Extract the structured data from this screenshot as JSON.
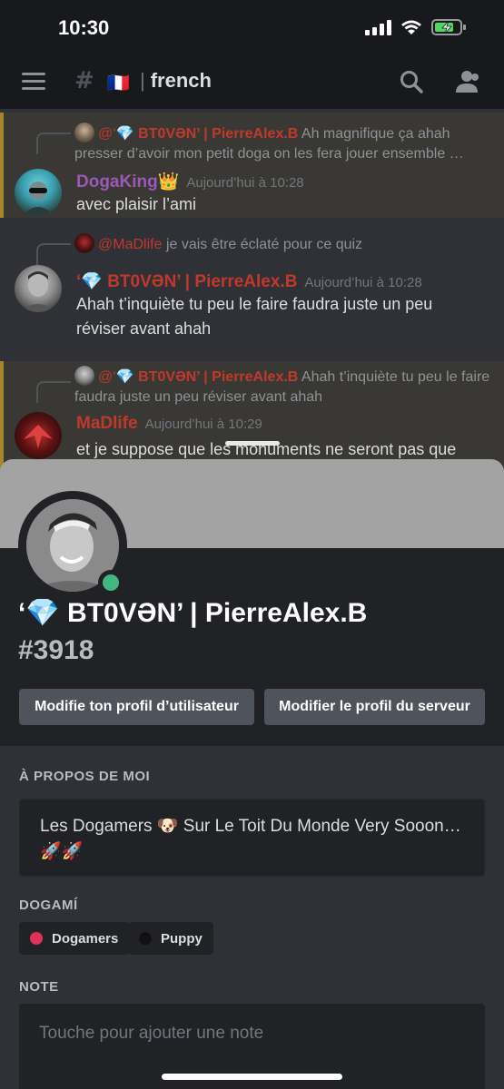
{
  "status_bar": {
    "time": "10:30"
  },
  "header": {
    "flag": "🇫🇷",
    "separator": "|",
    "channel_name": "french",
    "icons": [
      "menu-icon",
      "channel-hash-lock-icon",
      "search-icon",
      "members-icon"
    ]
  },
  "messages": [
    {
      "reply_prefix": "@‘💎",
      "reply_name": "BT0VƏN’ | PierreAlex.B",
      "reply_text": "Ah magnifique ça ahah presser d’avoir mon petit doga on les fera jouer ensemble …",
      "author": "DogaKing👑",
      "author_color": "#9b59b6",
      "timestamp": "Aujourd’hui à 10:28",
      "text": "avec plaisir l’ami"
    },
    {
      "reply_name": "@MaDlife",
      "reply_text": "je vais être éclaté pour ce quiz",
      "author": "‘💎 BT0VƏN’ | PierreAlex.B",
      "author_color": "#c0392b",
      "timestamp": "Aujourd’hui à 10:28",
      "text": "Ahah t’inquiète tu peu le faire faudra juste un peu réviser avant ahah"
    },
    {
      "reply_prefix": "@‘💎",
      "reply_name": "BT0VƏN’ | PierreAlex.B",
      "reply_text": "Ahah t’inquiète tu peu le faire faudra juste un peu réviser avant ahah",
      "author": "MaDlife",
      "author_color": "#c0392b",
      "timestamp": "Aujourd’hui à 10:29",
      "text": "et je suppose que les monuments ne seront pas que"
    }
  ],
  "profile": {
    "name": "‘💎 BT0VƏN’ | PierreAlex.B",
    "tag": "#3918",
    "status": "online",
    "edit_user_profile_label": "Modifie ton profil d’utilisateur",
    "edit_server_profile_label": "Modifier le profil du serveur",
    "about_title": "À PROPOS DE MOI",
    "about_text": "Les Dogamers 🐶 Sur Le Toit Du Monde Very Sooon… 🚀🚀",
    "roles_title": "DOGAMÍ",
    "roles": [
      {
        "name": "Dogamers",
        "color": "#e0315b"
      },
      {
        "name": "Puppy",
        "color": "#111111"
      }
    ],
    "note_title": "NOTE",
    "note_placeholder": "Touche pour ajouter une note"
  }
}
